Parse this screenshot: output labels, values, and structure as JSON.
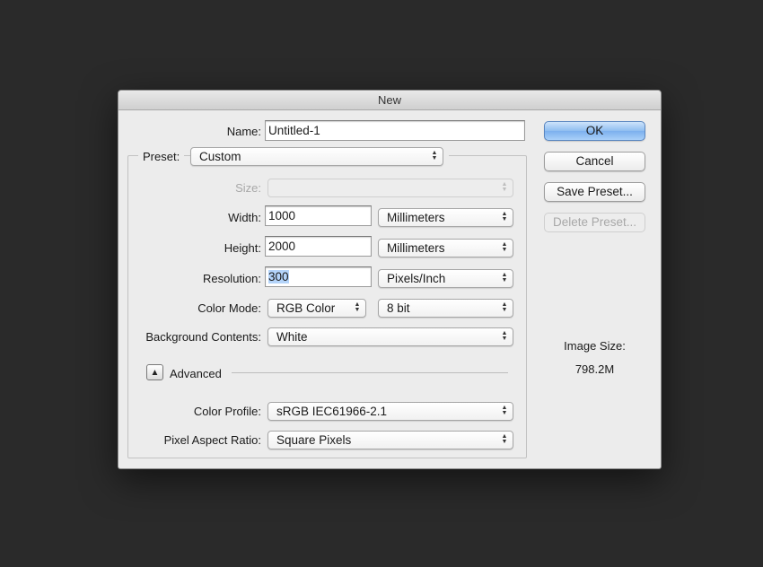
{
  "dialog": {
    "title": "New",
    "name_label": "Name:",
    "name_value": "Untitled-1",
    "preset_label": "Preset:",
    "preset_value": "Custom",
    "size_label": "Size:",
    "size_value": "",
    "width_label": "Width:",
    "width_value": "1000",
    "width_unit": "Millimeters",
    "height_label": "Height:",
    "height_value": "2000",
    "height_unit": "Millimeters",
    "resolution_label": "Resolution:",
    "resolution_value": "300",
    "resolution_unit": "Pixels/Inch",
    "color_mode_label": "Color Mode:",
    "color_mode_value": "RGB Color",
    "bit_depth_value": "8 bit",
    "background_label": "Background Contents:",
    "background_value": "White",
    "advanced_label": "Advanced",
    "color_profile_label": "Color Profile:",
    "color_profile_value": "sRGB IEC61966-2.1",
    "pixel_aspect_label": "Pixel Aspect Ratio:",
    "pixel_aspect_value": "Square Pixels"
  },
  "buttons": {
    "ok": "OK",
    "cancel": "Cancel",
    "save_preset": "Save Preset...",
    "delete_preset": "Delete Preset..."
  },
  "image_size": {
    "label": "Image Size:",
    "value": "798.2M"
  },
  "icons": {
    "select_arrows": "updown-chevron-icon",
    "advanced_toggle": "triangle-up-icon"
  },
  "colors": {
    "background": "#2a2a2a",
    "dialog": "#ececec",
    "default_button": "#8fbdf0",
    "selection_highlight": "#b4d4fa"
  }
}
